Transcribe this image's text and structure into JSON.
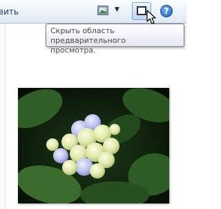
{
  "toolbar": {
    "cut_label": "вить",
    "view_icon": "view-options-icon",
    "view_arrow_icon": "chevron-down-icon",
    "preview_pane_icon": "preview-pane-icon",
    "help_icon": "help-icon",
    "help_glyph": "?"
  },
  "tooltip": {
    "line1": "Скрыть область предварительного",
    "line2": "просмотра."
  },
  "preview": {
    "image": "hydrangea-photo"
  },
  "colors": {
    "toolbar_top": "#fbfdff",
    "toolbar_bottom": "#dde8f5",
    "accent": "#1e5fb3"
  }
}
